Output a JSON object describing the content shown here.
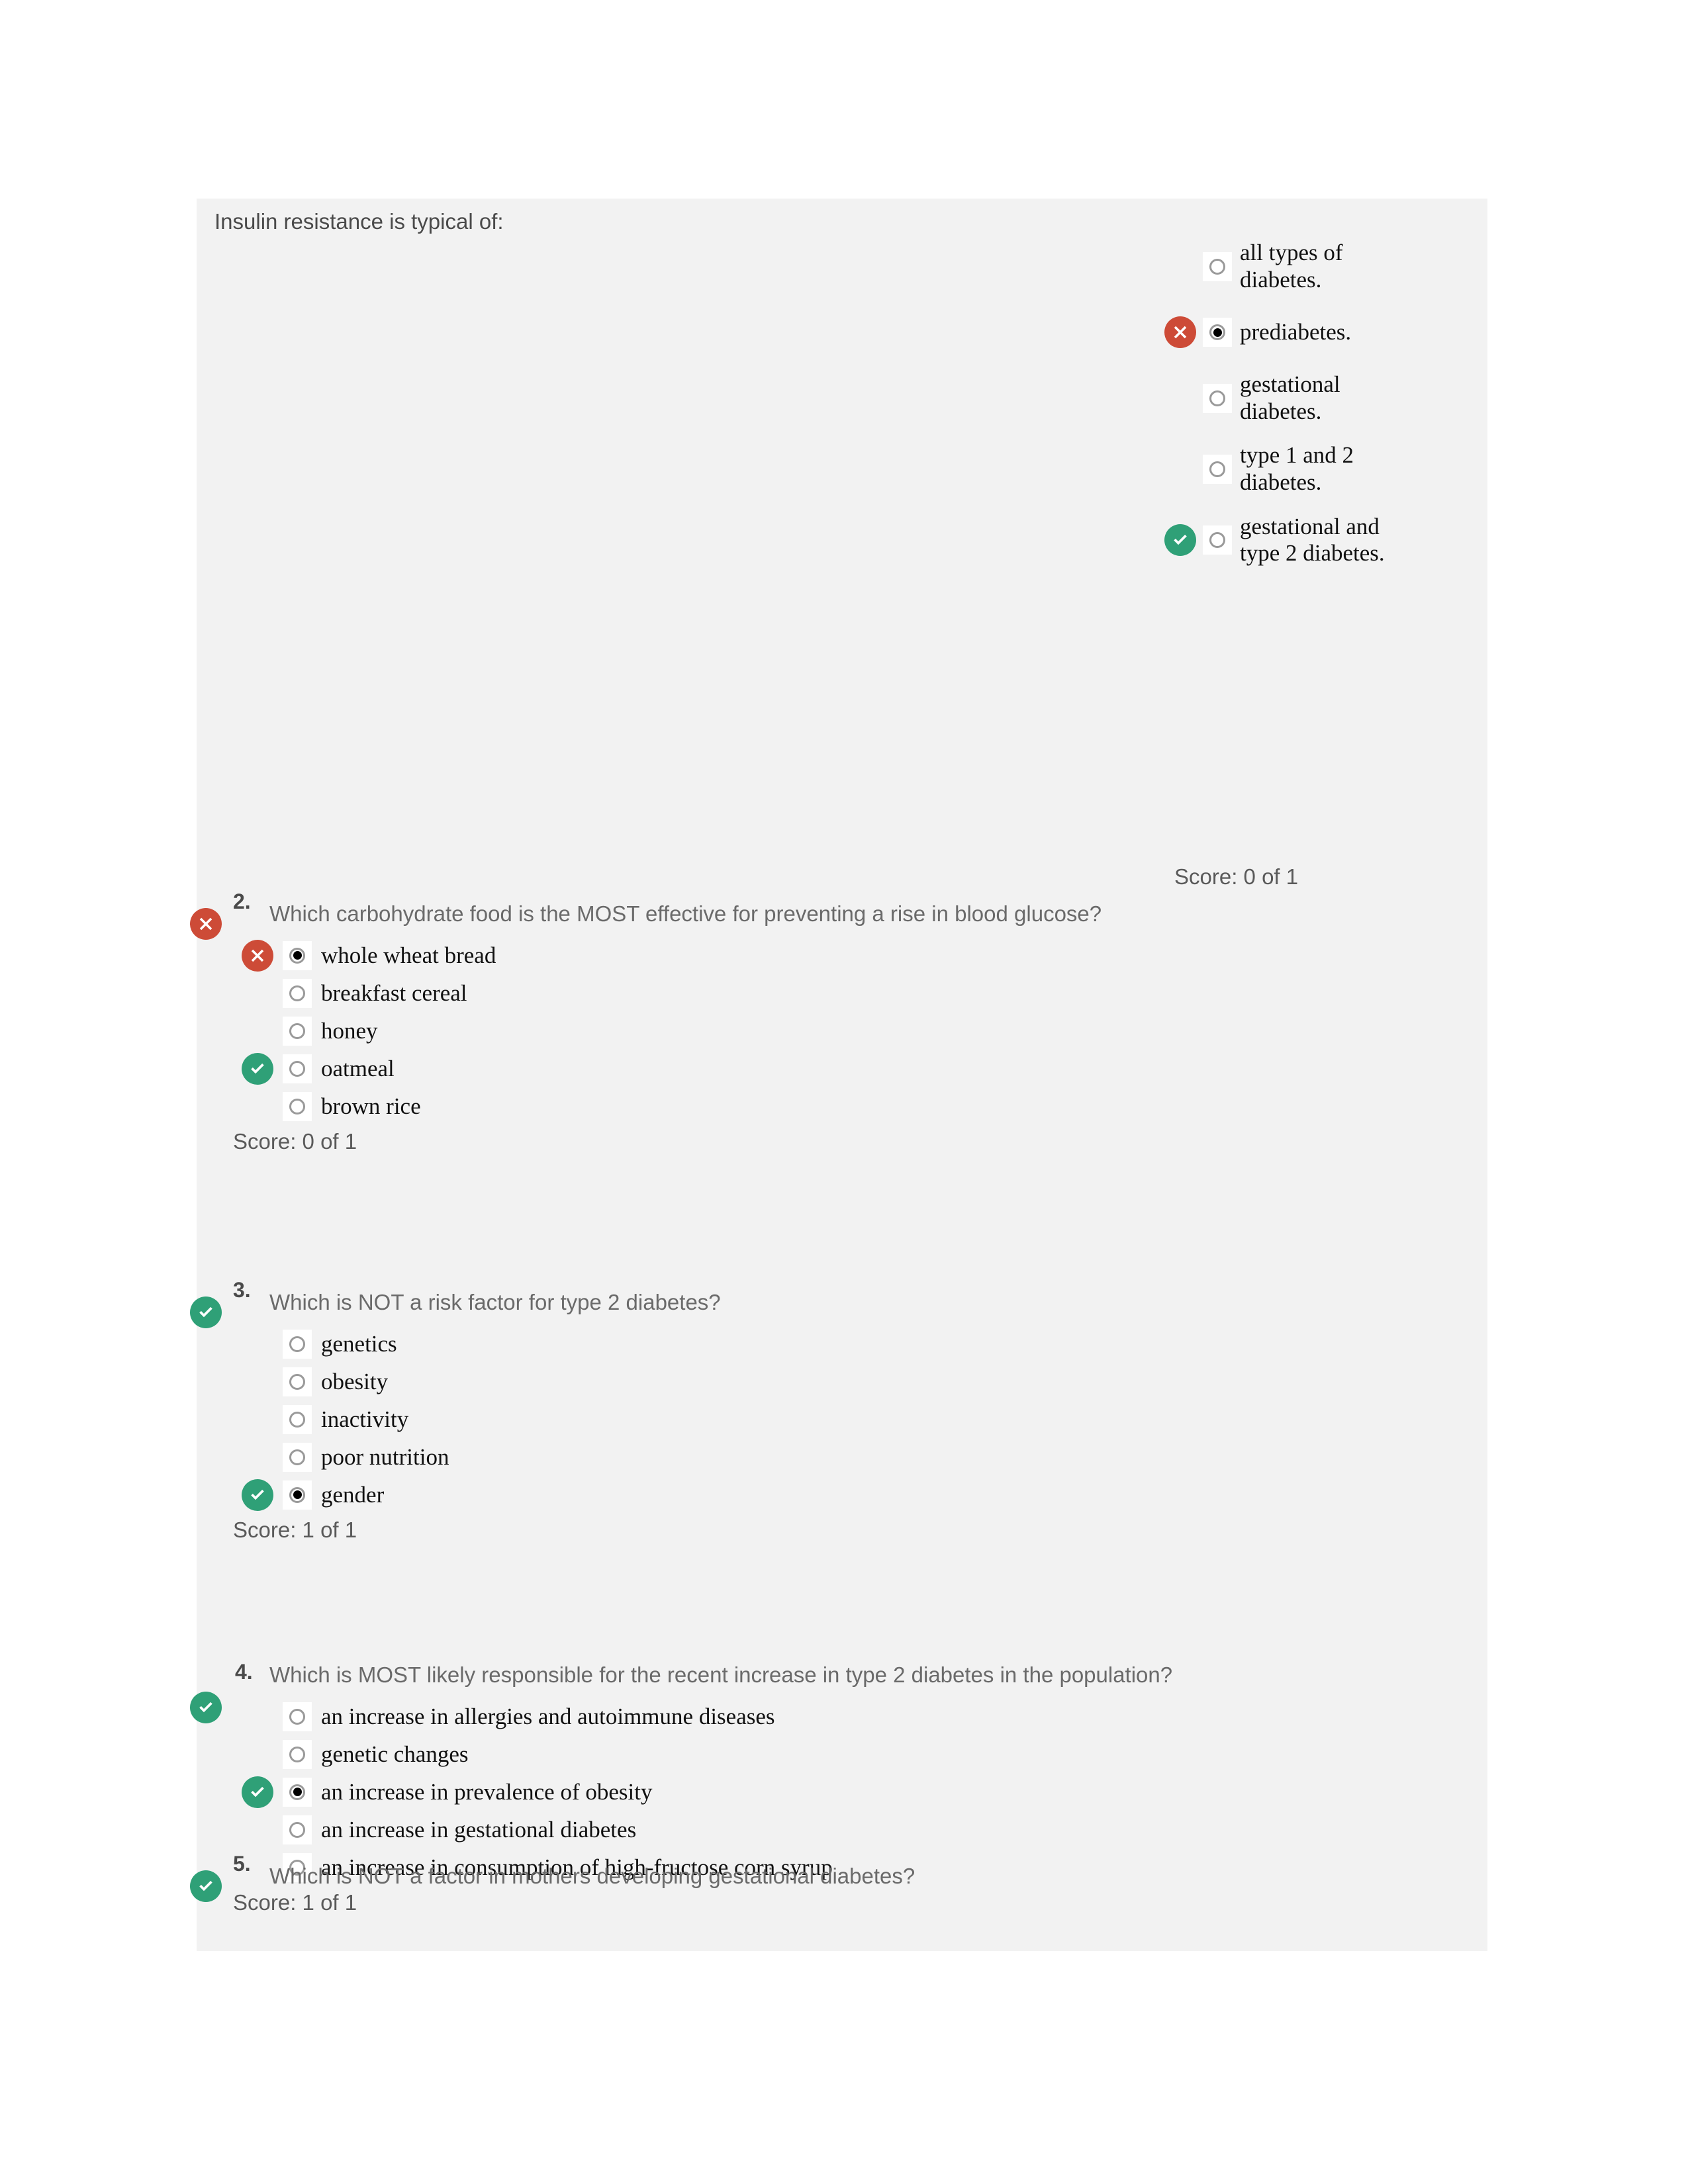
{
  "theme": {
    "panel_bg": "#f2f2f2",
    "page_bg": "#ffffff",
    "wrong_color": "#cd4b37",
    "right_color": "#2fa077",
    "question_text_color": "#6a6a6a",
    "option_text_color": "#111111"
  },
  "icons": {
    "wrong": "x-circle-icon",
    "right": "check-circle-icon",
    "radio": "radio-button-icon"
  },
  "questions": [
    {
      "number": "",
      "stem": "Insulin resistance is typical of:",
      "status": "",
      "score": "Score: 0 of 1",
      "options": [
        {
          "label": "all types of diabetes.",
          "selected": false,
          "mark": ""
        },
        {
          "label": "prediabetes.",
          "selected": true,
          "mark": "wrong"
        },
        {
          "label": "gestational diabetes.",
          "selected": false,
          "mark": ""
        },
        {
          "label": "type 1 and 2 diabetes.",
          "selected": false,
          "mark": ""
        },
        {
          "label": "gestational and type 2 diabetes.",
          "selected": false,
          "mark": "right"
        }
      ]
    },
    {
      "number": "2.",
      "stem": "Which carbohydrate food is the MOST effective for preventing a rise in blood glucose?",
      "status": "wrong",
      "score": "Score: 0 of 1",
      "options": [
        {
          "label": "whole wheat bread",
          "selected": true,
          "mark": "wrong"
        },
        {
          "label": "breakfast cereal",
          "selected": false,
          "mark": ""
        },
        {
          "label": "honey",
          "selected": false,
          "mark": ""
        },
        {
          "label": "oatmeal",
          "selected": false,
          "mark": "right"
        },
        {
          "label": "brown rice",
          "selected": false,
          "mark": ""
        }
      ]
    },
    {
      "number": "3.",
      "stem": "Which is NOT a risk factor for type 2 diabetes?",
      "status": "right",
      "score": "Score: 1 of 1",
      "options": [
        {
          "label": "genetics",
          "selected": false,
          "mark": ""
        },
        {
          "label": "obesity",
          "selected": false,
          "mark": ""
        },
        {
          "label": "inactivity",
          "selected": false,
          "mark": ""
        },
        {
          "label": "poor nutrition",
          "selected": false,
          "mark": ""
        },
        {
          "label": "gender",
          "selected": true,
          "mark": "right"
        }
      ]
    },
    {
      "number": "4.",
      "stem": "Which is MOST likely responsible for the recent increase in type 2 diabetes in the population?",
      "status": "right",
      "score": "Score: 1 of 1",
      "options": [
        {
          "label": "an increase in allergies and autoimmune diseases",
          "selected": false,
          "mark": ""
        },
        {
          "label": "genetic changes",
          "selected": false,
          "mark": ""
        },
        {
          "label": "an increase in prevalence of obesity",
          "selected": true,
          "mark": "right"
        },
        {
          "label": "an increase in gestational diabetes",
          "selected": false,
          "mark": ""
        },
        {
          "label": "an increase in consumption of high-fructose corn syrup",
          "selected": false,
          "mark": ""
        }
      ]
    },
    {
      "number": "5.",
      "stem": "Which is NOT a factor in mothers developing gestational diabetes?",
      "status": "right",
      "score": "",
      "options": []
    }
  ]
}
